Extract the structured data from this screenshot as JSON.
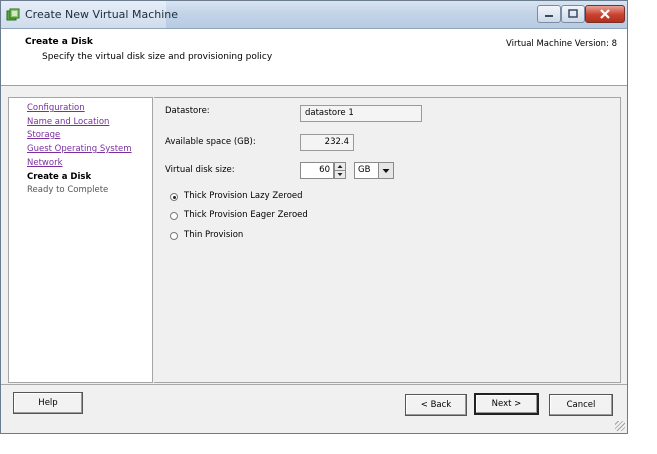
{
  "window": {
    "title": "Create New Virtual Machine",
    "title_color": "#1c2a3a"
  },
  "header": {
    "title": "Create a Disk",
    "subtitle": "Specify the virtual disk size and provisioning policy",
    "version": "Virtual Machine Version: 8"
  },
  "sidebar": {
    "steps": [
      {
        "label": "Configuration",
        "state": "visited"
      },
      {
        "label": "Name and Location",
        "state": "visited"
      },
      {
        "label": "Storage",
        "state": "visited"
      },
      {
        "label": "Guest Operating System",
        "state": "visited"
      },
      {
        "label": "Network",
        "state": "visited"
      },
      {
        "label": "Create a Disk",
        "state": "current"
      },
      {
        "label": "Ready to Complete",
        "state": "pending"
      }
    ]
  },
  "form": {
    "datastore_label": "Datastore:",
    "datastore_value": "datastore 1",
    "available_label": "Available space (GB):",
    "available_value": "232.4",
    "disk_size_label": "Virtual disk size:",
    "disk_size_value": "60",
    "disk_unit": "GB",
    "provisioning": [
      {
        "label": "Thick Provision Lazy Zeroed",
        "selected": true
      },
      {
        "label": "Thick Provision Eager Zeroed",
        "selected": false
      },
      {
        "label": "Thin Provision",
        "selected": false
      }
    ]
  },
  "footer": {
    "help": "Help",
    "back": "< Back",
    "next": "Next >",
    "cancel": "Cancel"
  },
  "colors": {
    "link": "#7a2ea0",
    "close_button": "#c9412f"
  }
}
